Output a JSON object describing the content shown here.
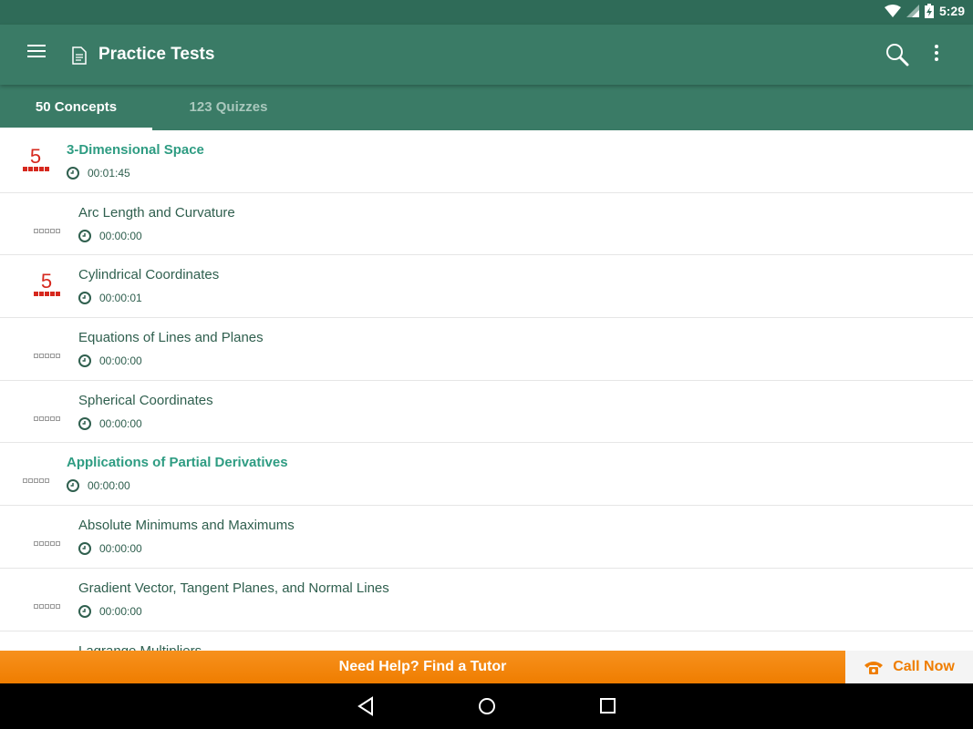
{
  "status_bar": {
    "time": "5:29"
  },
  "app_bar": {
    "title": "Practice Tests"
  },
  "tabs": [
    {
      "label": "50 Concepts",
      "selected": true
    },
    {
      "label": "123 Quizzes",
      "selected": false
    }
  ],
  "rows": [
    {
      "title": "3-Dimensional Space",
      "time": "00:01:45",
      "score": "5",
      "header": true
    },
    {
      "title": "Arc Length and Curvature",
      "time": "00:00:00",
      "score": "",
      "header": false
    },
    {
      "title": "Cylindrical Coordinates",
      "time": "00:00:01",
      "score": "5",
      "header": false
    },
    {
      "title": "Equations of Lines and Planes",
      "time": "00:00:00",
      "score": "",
      "header": false
    },
    {
      "title": "Spherical Coordinates",
      "time": "00:00:00",
      "score": "",
      "header": false
    },
    {
      "title": "Applications of Partial Derivatives",
      "time": "00:00:00",
      "score": "",
      "header": true
    },
    {
      "title": "Absolute Minimums and Maximums",
      "time": "00:00:00",
      "score": "",
      "header": false
    },
    {
      "title": "Gradient Vector, Tangent Planes, and Normal Lines",
      "time": "00:00:00",
      "score": "",
      "header": false
    },
    {
      "title": "Lagrange Multipliers",
      "time": "",
      "score": "",
      "header": false
    }
  ],
  "banner": {
    "label": "Need Help? Find a Tutor"
  },
  "call": {
    "label": "Call Now"
  },
  "colors": {
    "primary": "#3a7b66",
    "accent": "#2e9c82",
    "score": "#d6281e",
    "banner": "#ef7d00"
  }
}
